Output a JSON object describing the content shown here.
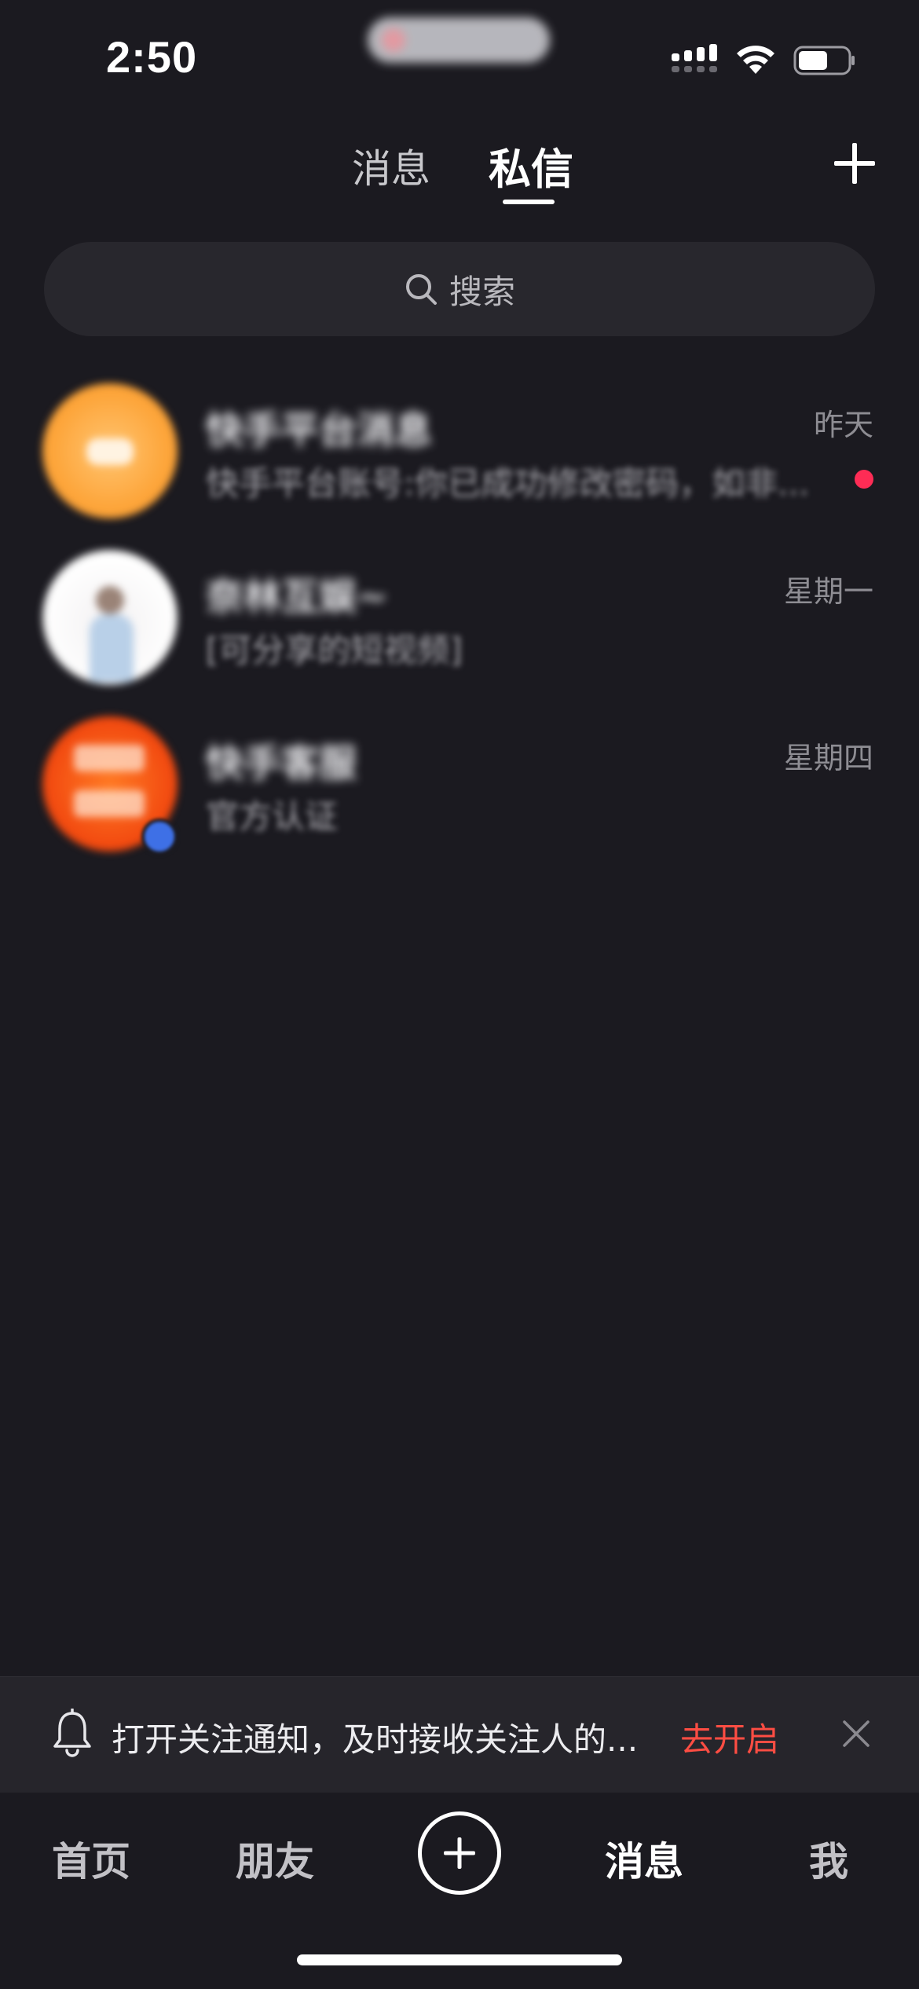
{
  "status_bar": {
    "time": "2:50"
  },
  "header": {
    "tabs": [
      {
        "label": "消息",
        "active": false
      },
      {
        "label": "私信",
        "active": true
      }
    ],
    "add_icon": "plus-icon"
  },
  "search": {
    "label": "搜索",
    "icon": "search-icon"
  },
  "conversations": [
    {
      "name": "快手平台消息",
      "preview": "快手平台账号:你已成功修改密码，如非...",
      "time": "昨天",
      "unread": true
    },
    {
      "name": "奈林互娱~",
      "preview": "[可分享的短视频]",
      "time": "星期一",
      "unread": false
    },
    {
      "name": "快手客服",
      "preview": "官方认证",
      "time": "星期四",
      "unread": false,
      "verified": true
    }
  ],
  "notice": {
    "text": "打开关注通知，及时接收关注人的...",
    "action": "去开启",
    "icons": [
      "bell-icon",
      "close-icon"
    ]
  },
  "bottom_nav": {
    "items": [
      {
        "label": "首页"
      },
      {
        "label": "朋友"
      },
      {
        "label": "消息",
        "active": true
      },
      {
        "label": "我"
      }
    ],
    "create_icon": "plus-circle-icon"
  },
  "colors": {
    "background": "#1b1a20",
    "accent_red": "#fe4d43",
    "unread_dot": "#fe2c55"
  }
}
